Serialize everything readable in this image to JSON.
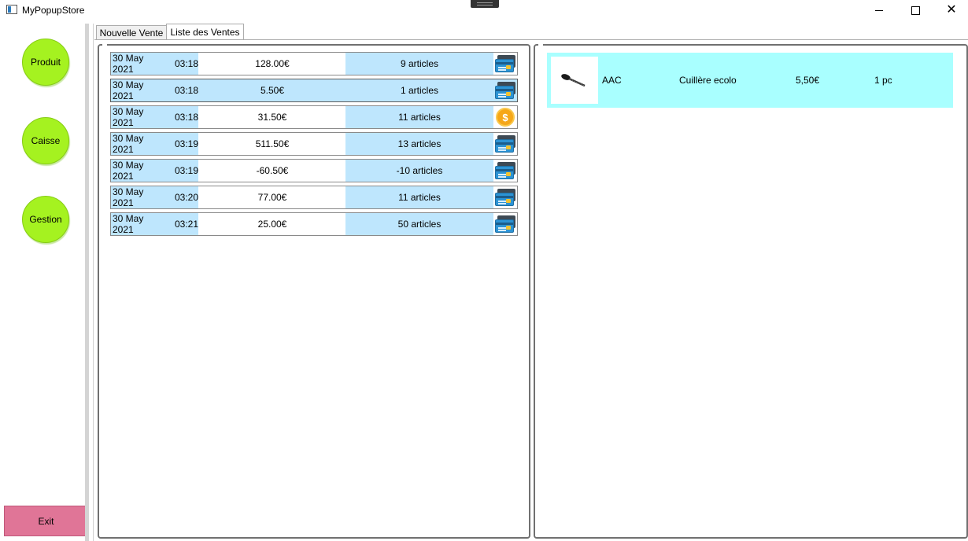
{
  "window": {
    "title": "MyPopupStore",
    "accent": "#bee6fd"
  },
  "sidebar": {
    "buttons": [
      {
        "label": "Produit"
      },
      {
        "label": "Caisse"
      },
      {
        "label": "Gestion"
      }
    ],
    "exit_label": "Exit",
    "button_color": "#a5f220",
    "exit_color": "#e07597"
  },
  "tabs": [
    {
      "label": "Nouvelle Vente",
      "active": false
    },
    {
      "label": "Liste des Ventes",
      "active": true
    }
  ],
  "sales": [
    {
      "date": "30 May 2021",
      "time": "03:18",
      "amount": "128.00€",
      "count": "9 articles",
      "payment": "card-icon"
    },
    {
      "date": "30 May 2021",
      "time": "03:18",
      "amount": "5.50€",
      "count": "1 articles",
      "payment": "card-icon",
      "selected": true
    },
    {
      "date": "30 May 2021",
      "time": "03:18",
      "amount": "31.50€",
      "count": "11 articles",
      "payment": "coin-icon"
    },
    {
      "date": "30 May 2021",
      "time": "03:19",
      "amount": "511.50€",
      "count": "13 articles",
      "payment": "card-icon"
    },
    {
      "date": "30 May 2021",
      "time": "03:19",
      "amount": "-60.50€",
      "count": "-10 articles",
      "payment": "card-icon"
    },
    {
      "date": "30 May 2021",
      "time": "03:20",
      "amount": "77.00€",
      "count": "11 articles",
      "payment": "card-icon"
    },
    {
      "date": "30 May 2021",
      "time": "03:21",
      "amount": "25.00€",
      "count": "50 articles",
      "payment": "card-icon"
    }
  ],
  "detail": {
    "items": [
      {
        "image": "spoon-icon",
        "code": "AAC",
        "name": "Cuillère ecolo",
        "price": "5,50€",
        "qty": "1 pc"
      }
    ],
    "row_color": "#a9ffff"
  }
}
